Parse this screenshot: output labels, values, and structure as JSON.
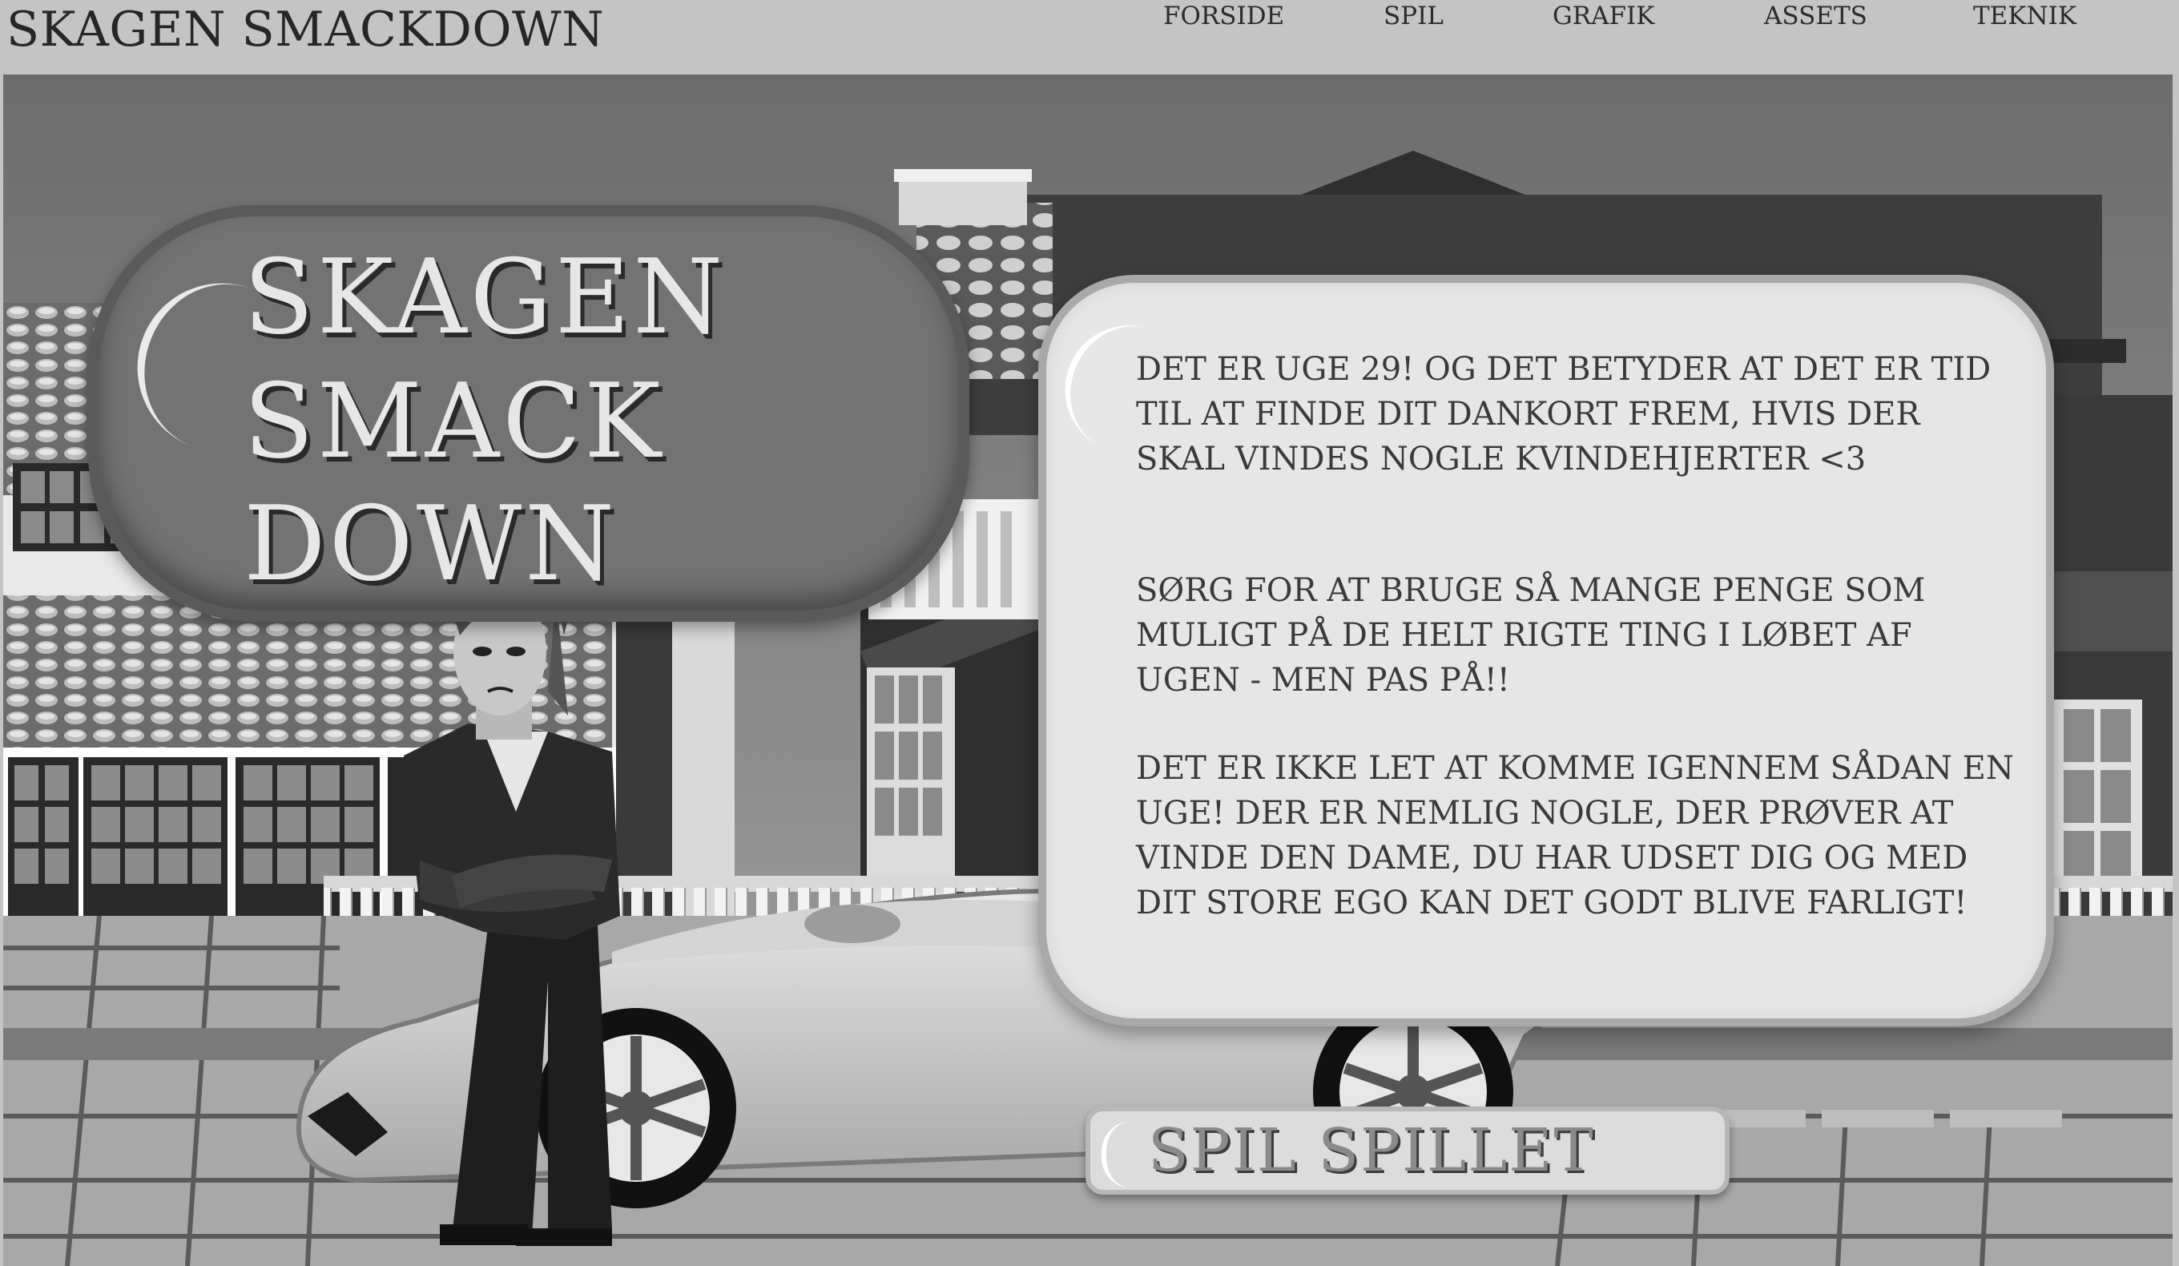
{
  "site": {
    "title": "SKAGEN SMACKDOWN"
  },
  "nav": [
    {
      "label": "FORSIDE"
    },
    {
      "label": "SPIL"
    },
    {
      "label": "GRAFIK"
    },
    {
      "label": "ASSETS"
    },
    {
      "label": "TEKNIK"
    }
  ],
  "logo": {
    "lines": [
      "SKAGEN",
      "SMACK",
      "DOWN"
    ]
  },
  "info": {
    "paragraphs": [
      "DET ER UGE 29! OG DET BETYDER AT DET ER TID TIL AT FINDE DIT DANKORT FREM, HVIS DER SKAL VINDES NOGLE KVINDEHJERTER <3",
      "SØRG FOR AT BRUGE SÅ MANGE PENGE SOM MULIGT PÅ DE HELT RIGTE TING I LØBET AF UGEN - MEN PAS PÅ!!",
      "DET ER IKKE LET AT KOMME IGENNEM SÅDAN EN UGE! DER ER NEMLIG NOGLE, DER PRØVER AT VINDE DEN DAME, DU  HAR UDSET DIG OG MED DIT STORE EGO KAN DET GODT BLIVE FARLIGT!"
    ]
  },
  "play_button": {
    "label": "SPIL SPILLET"
  },
  "colors": {
    "page_bg": "#c4c4c4",
    "logo_fill": "#737373",
    "bubble_fill": "#e6e6e6",
    "button_fill": "#dcdcdc"
  },
  "icons": {
    "logo_shine": "gloss-highlight",
    "button_shine": "gloss-highlight"
  }
}
